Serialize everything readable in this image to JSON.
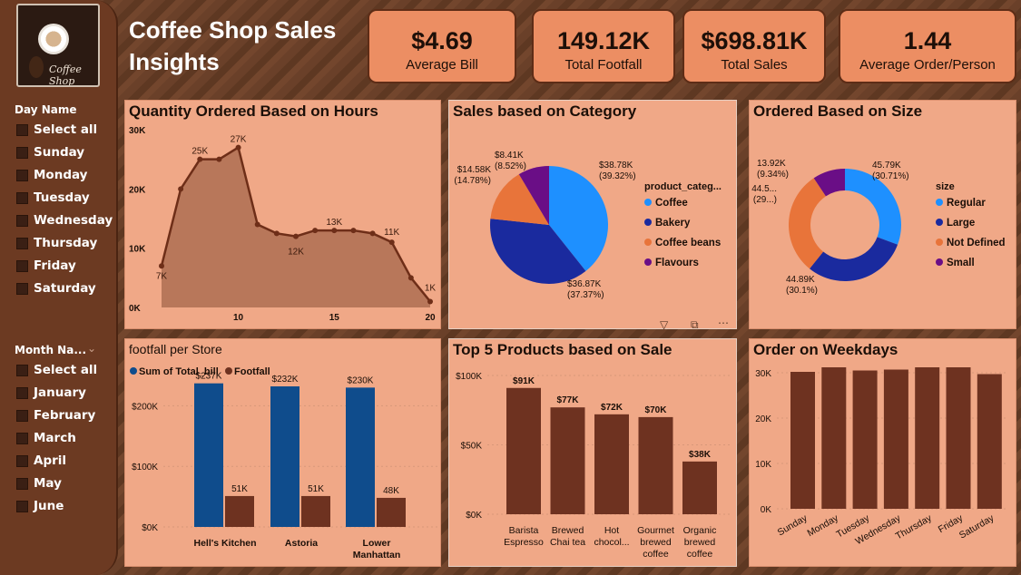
{
  "app_title": "Coffee Shop Sales Insights",
  "logo_text": "Coffee Shop",
  "kpis": [
    {
      "value": "$4.69",
      "label": "Average Bill"
    },
    {
      "value": "149.12K",
      "label": "Total Footfall"
    },
    {
      "value": "$698.81K",
      "label": "Total Sales"
    },
    {
      "value": "1.44",
      "label": "Average Order/Person"
    }
  ],
  "day_slicer": {
    "title": "Day Name",
    "items": [
      "Select all",
      "Sunday",
      "Monday",
      "Tuesday",
      "Wednesday",
      "Thursday",
      "Friday",
      "Saturday"
    ]
  },
  "month_slicer": {
    "title": "Month Na...",
    "items": [
      "Select all",
      "January",
      "February",
      "March",
      "April",
      "May",
      "June"
    ]
  },
  "colors": {
    "brown": "#6e3220",
    "blue": "#0f4c8c",
    "donut_blue": "#1e90ff",
    "navy": "#1a2a9e",
    "orange": "#e8743a",
    "purple": "#6a0e86"
  },
  "chart_data": [
    {
      "type": "area",
      "title": "Quantity Ordered Based on Hours",
      "x": [
        6,
        7,
        8,
        9,
        10,
        11,
        12,
        13,
        14,
        15,
        16,
        17,
        18,
        19,
        20
      ],
      "values": [
        7000,
        20000,
        25000,
        25000,
        27000,
        14000,
        12500,
        12000,
        13000,
        13000,
        13000,
        12500,
        11000,
        5000,
        1000
      ],
      "data_labels": [
        {
          "x": 6,
          "text": "7K"
        },
        {
          "x": 8,
          "text": "25K"
        },
        {
          "x": 10,
          "text": "27K"
        },
        {
          "x": 13,
          "text": "12K"
        },
        {
          "x": 15,
          "text": "13K"
        },
        {
          "x": 18,
          "text": "11K"
        },
        {
          "x": 20,
          "text": "1K"
        }
      ],
      "xticks": [
        "10",
        "15",
        "20"
      ],
      "yticks": [
        "0K",
        "10K",
        "20K",
        "30K"
      ],
      "ylim": [
        0,
        30000
      ]
    },
    {
      "type": "pie",
      "title": "Sales based on Category",
      "legend_title": "product_categ...",
      "slices": [
        {
          "name": "Coffee",
          "value": 38.78,
          "label": "$38.78K",
          "pct": "(39.32%)"
        },
        {
          "name": "Bakery",
          "value": 36.87,
          "label": "$36.87K",
          "pct": "(37.37%)"
        },
        {
          "name": "Coffee beans",
          "value": 14.58,
          "label": "$14.58K",
          "pct": "(14.78%)"
        },
        {
          "name": "Flavours",
          "value": 8.41,
          "label": "$8.41K",
          "pct": "(8.52%)"
        }
      ]
    },
    {
      "type": "pie",
      "title": "Ordered Based on Size",
      "legend_title": "size",
      "slices": [
        {
          "name": "Regular",
          "value": 45.79,
          "label": "45.79K",
          "pct": "(30.71%)"
        },
        {
          "name": "Large",
          "value": 44.89,
          "label": "44.89K",
          "pct": "(30.1%)"
        },
        {
          "name": "Not Defined",
          "value": 44.5,
          "label": "44.5...",
          "pct": "(29...)"
        },
        {
          "name": "Small",
          "value": 13.92,
          "label": "13.92K",
          "pct": "(9.34%)"
        }
      ]
    },
    {
      "type": "bar",
      "title": "footfall per Store",
      "legend": [
        "Sum of Total_bill",
        "Footfall"
      ],
      "categories": [
        "Hell's Kitchen",
        "Astoria",
        "Lower Manhattan"
      ],
      "series": [
        {
          "name": "Sum of Total_bill",
          "values": [
            237,
            232,
            230
          ],
          "labels": [
            "$237K",
            "$232K",
            "$230K"
          ]
        },
        {
          "name": "Footfall",
          "values": [
            51,
            51,
            48
          ],
          "labels": [
            "51K",
            "51K",
            "48K"
          ]
        }
      ],
      "yticks": [
        "$0K",
        "$100K",
        "$200K"
      ],
      "ylim": [
        0,
        250
      ]
    },
    {
      "type": "bar",
      "title": "Top 5 Products based on Sale",
      "categories": [
        "Barista Espresso",
        "Brewed Chai tea",
        "Hot chocol...",
        "Gourmet brewed coffee",
        "Organic brewed coffee"
      ],
      "values": [
        91,
        77,
        72,
        70,
        38
      ],
      "labels": [
        "$91K",
        "$77K",
        "$72K",
        "$70K",
        "$38K"
      ],
      "yticks": [
        "$0K",
        "$50K",
        "$100K"
      ],
      "ylim": [
        0,
        100
      ]
    },
    {
      "type": "bar",
      "title": "Order on Weekdays",
      "categories": [
        "Sunday",
        "Monday",
        "Tuesday",
        "Wednesday",
        "Thursday",
        "Friday",
        "Saturday"
      ],
      "values": [
        30200,
        31200,
        30500,
        30700,
        31200,
        31200,
        29700
      ],
      "yticks": [
        "0K",
        "10K",
        "20K",
        "30K"
      ],
      "ylim": [
        0,
        33000
      ]
    }
  ]
}
